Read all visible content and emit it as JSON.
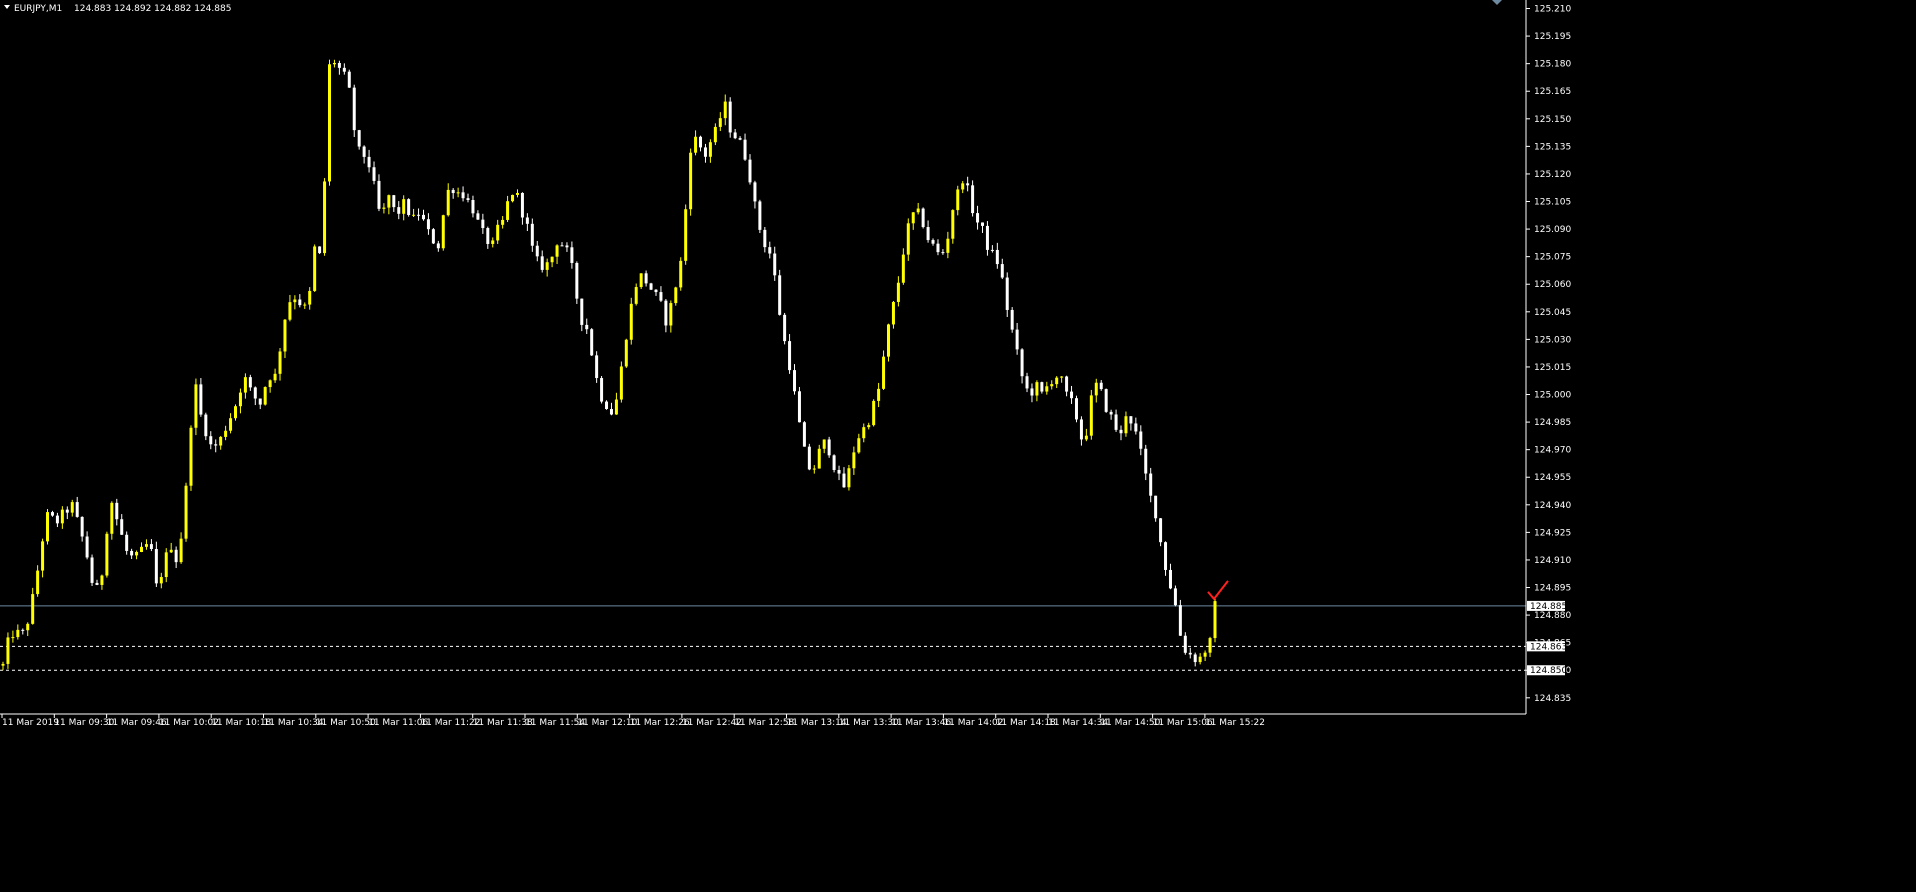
{
  "header": {
    "symbol": "EURJPY,M1",
    "ohlc": "124.883 124.892 124.882 124.885"
  },
  "colors": {
    "background": "#000000",
    "bull_candle": "#ffff00",
    "bear_candle": "#ffffff",
    "volume_tick": "#00c000",
    "bid_line": "#6e8aa0",
    "level_line": "#ffffff",
    "axis": "#ffffff",
    "check_mark": "#ff2020"
  },
  "chart_data": {
    "type": "candlestick",
    "symbol": "EURJPY",
    "timeframe": "M1",
    "x_labels": [
      "11 Mar 2019",
      "11 Mar 09:30",
      "11 Mar 09:46",
      "11 Mar 10:02",
      "11 Mar 10:18",
      "11 Mar 10:34",
      "11 Mar 10:50",
      "11 Mar 11:06",
      "11 Mar 11:22",
      "11 Mar 11:38",
      "11 Mar 11:54",
      "11 Mar 12:10",
      "11 Mar 12:26",
      "11 Mar 12:42",
      "11 Mar 12:58",
      "11 Mar 13:14",
      "11 Mar 13:30",
      "11 Mar 13:46",
      "11 Mar 14:02",
      "11 Mar 14:18",
      "11 Mar 14:34",
      "11 Mar 14:50",
      "11 Mar 15:06",
      "11 Mar 15:22"
    ],
    "y_ticks": [
      "125.210",
      "125.195",
      "125.180",
      "125.165",
      "125.150",
      "125.135",
      "125.120",
      "125.105",
      "125.090",
      "125.075",
      "125.060",
      "125.045",
      "125.030",
      "125.015",
      "125.000",
      "124.985",
      "124.970",
      "124.955",
      "124.940",
      "124.925",
      "124.910",
      "124.895",
      "124.880",
      "124.865",
      "124.850",
      "124.835"
    ],
    "ylim": [
      124.83,
      125.213
    ],
    "bid_price": "124.885",
    "levels": [
      "124.863",
      "124.850"
    ],
    "price_path": [
      [
        0,
        124.845
      ],
      [
        10,
        124.87
      ],
      [
        18,
        124.87
      ],
      [
        25,
        124.87
      ],
      [
        35,
        124.895
      ],
      [
        42,
        124.92
      ],
      [
        48,
        124.935
      ],
      [
        56,
        124.93
      ],
      [
        63,
        124.935
      ],
      [
        72,
        124.94
      ],
      [
        78,
        124.93
      ],
      [
        86,
        124.915
      ],
      [
        95,
        124.89
      ],
      [
        103,
        124.905
      ],
      [
        110,
        124.945
      ],
      [
        118,
        124.93
      ],
      [
        126,
        124.915
      ],
      [
        134,
        124.91
      ],
      [
        142,
        124.915
      ],
      [
        150,
        124.92
      ],
      [
        156,
        124.895
      ],
      [
        163,
        124.905
      ],
      [
        170,
        124.92
      ],
      [
        176,
        124.91
      ],
      [
        182,
        124.925
      ],
      [
        188,
        124.96
      ],
      [
        194,
        125.01
      ],
      [
        200,
        124.99
      ],
      [
        206,
        124.98
      ],
      [
        212,
        124.97
      ],
      [
        220,
        124.975
      ],
      [
        228,
        124.985
      ],
      [
        236,
        124.995
      ],
      [
        244,
        125.01
      ],
      [
        252,
        125.0
      ],
      [
        260,
        124.995
      ],
      [
        268,
        125.01
      ],
      [
        276,
        125.01
      ],
      [
        284,
        125.04
      ],
      [
        292,
        125.055
      ],
      [
        300,
        125.05
      ],
      [
        308,
        125.045
      ],
      [
        314,
        125.08
      ],
      [
        320,
        125.075
      ],
      [
        325,
        125.12
      ],
      [
        330,
        125.185
      ],
      [
        336,
        125.18
      ],
      [
        342,
        125.175
      ],
      [
        348,
        125.17
      ],
      [
        354,
        125.145
      ],
      [
        360,
        125.13
      ],
      [
        366,
        125.13
      ],
      [
        372,
        125.12
      ],
      [
        378,
        125.1
      ],
      [
        384,
        125.1
      ],
      [
        390,
        125.11
      ],
      [
        396,
        125.095
      ],
      [
        402,
        125.105
      ],
      [
        408,
        125.1
      ],
      [
        414,
        125.095
      ],
      [
        420,
        125.1
      ],
      [
        426,
        125.09
      ],
      [
        432,
        125.085
      ],
      [
        438,
        125.08
      ],
      [
        444,
        125.1
      ],
      [
        450,
        125.115
      ],
      [
        456,
        125.11
      ],
      [
        462,
        125.11
      ],
      [
        468,
        125.105
      ],
      [
        474,
        125.1
      ],
      [
        480,
        125.09
      ],
      [
        486,
        125.085
      ],
      [
        492,
        125.08
      ],
      [
        498,
        125.09
      ],
      [
        504,
        125.095
      ],
      [
        510,
        125.11
      ],
      [
        516,
        125.11
      ],
      [
        522,
        125.1
      ],
      [
        528,
        125.09
      ],
      [
        534,
        125.075
      ],
      [
        540,
        125.07
      ],
      [
        546,
        125.07
      ],
      [
        552,
        125.075
      ],
      [
        558,
        125.085
      ],
      [
        564,
        125.08
      ],
      [
        570,
        125.075
      ],
      [
        576,
        125.055
      ],
      [
        582,
        125.04
      ],
      [
        588,
        125.035
      ],
      [
        594,
        125.015
      ],
      [
        600,
        125.0
      ],
      [
        606,
        124.995
      ],
      [
        612,
        124.99
      ],
      [
        618,
        125.0
      ],
      [
        624,
        125.025
      ],
      [
        630,
        125.045
      ],
      [
        636,
        125.06
      ],
      [
        642,
        125.065
      ],
      [
        648,
        125.06
      ],
      [
        654,
        125.055
      ],
      [
        660,
        125.05
      ],
      [
        666,
        125.04
      ],
      [
        672,
        125.05
      ],
      [
        678,
        125.065
      ],
      [
        684,
        125.08
      ],
      [
        688,
        125.13
      ],
      [
        694,
        125.14
      ],
      [
        700,
        125.135
      ],
      [
        706,
        125.13
      ],
      [
        712,
        125.14
      ],
      [
        718,
        125.145
      ],
      [
        724,
        125.16
      ],
      [
        730,
        125.145
      ],
      [
        736,
        125.14
      ],
      [
        742,
        125.135
      ],
      [
        748,
        125.125
      ],
      [
        754,
        125.105
      ],
      [
        760,
        125.09
      ],
      [
        766,
        125.08
      ],
      [
        772,
        125.075
      ],
      [
        778,
        125.05
      ],
      [
        784,
        125.03
      ],
      [
        790,
        125.015
      ],
      [
        796,
        124.995
      ],
      [
        802,
        124.975
      ],
      [
        808,
        124.96
      ],
      [
        814,
        124.96
      ],
      [
        820,
        124.97
      ],
      [
        826,
        124.975
      ],
      [
        832,
        124.965
      ],
      [
        838,
        124.955
      ],
      [
        844,
        124.95
      ],
      [
        850,
        124.96
      ],
      [
        856,
        124.975
      ],
      [
        862,
        124.98
      ],
      [
        868,
        124.985
      ],
      [
        874,
        124.995
      ],
      [
        880,
        125.005
      ],
      [
        886,
        125.03
      ],
      [
        892,
        125.045
      ],
      [
        898,
        125.06
      ],
      [
        904,
        125.08
      ],
      [
        910,
        125.095
      ],
      [
        916,
        125.1
      ],
      [
        922,
        125.095
      ],
      [
        928,
        125.085
      ],
      [
        934,
        125.08
      ],
      [
        940,
        125.075
      ],
      [
        946,
        125.08
      ],
      [
        952,
        125.1
      ],
      [
        958,
        125.11
      ],
      [
        964,
        125.12
      ],
      [
        970,
        125.105
      ],
      [
        976,
        125.095
      ],
      [
        982,
        125.09
      ],
      [
        988,
        125.08
      ],
      [
        994,
        125.075
      ],
      [
        1000,
        125.07
      ],
      [
        1006,
        125.05
      ],
      [
        1012,
        125.035
      ],
      [
        1018,
        125.02
      ],
      [
        1024,
        125.005
      ],
      [
        1030,
        125.0
      ],
      [
        1036,
        125.005
      ],
      [
        1042,
        125.0
      ],
      [
        1048,
        125.005
      ],
      [
        1054,
        125.01
      ],
      [
        1060,
        125.01
      ],
      [
        1066,
        125.0
      ],
      [
        1072,
        124.995
      ],
      [
        1078,
        124.985
      ],
      [
        1084,
        124.97
      ],
      [
        1090,
        124.995
      ],
      [
        1096,
        125.005
      ],
      [
        1102,
        125.0
      ],
      [
        1108,
        124.99
      ],
      [
        1114,
        124.985
      ],
      [
        1120,
        124.975
      ],
      [
        1126,
        124.99
      ],
      [
        1132,
        124.985
      ],
      [
        1138,
        124.975
      ],
      [
        1144,
        124.96
      ],
      [
        1150,
        124.945
      ],
      [
        1156,
        124.935
      ],
      [
        1162,
        124.915
      ],
      [
        1168,
        124.9
      ],
      [
        1174,
        124.89
      ],
      [
        1180,
        124.87
      ],
      [
        1186,
        124.86
      ],
      [
        1192,
        124.858
      ],
      [
        1198,
        124.855
      ],
      [
        1204,
        124.86
      ],
      [
        1210,
        124.865
      ],
      [
        1215,
        124.885
      ]
    ],
    "candle_count": 246
  }
}
